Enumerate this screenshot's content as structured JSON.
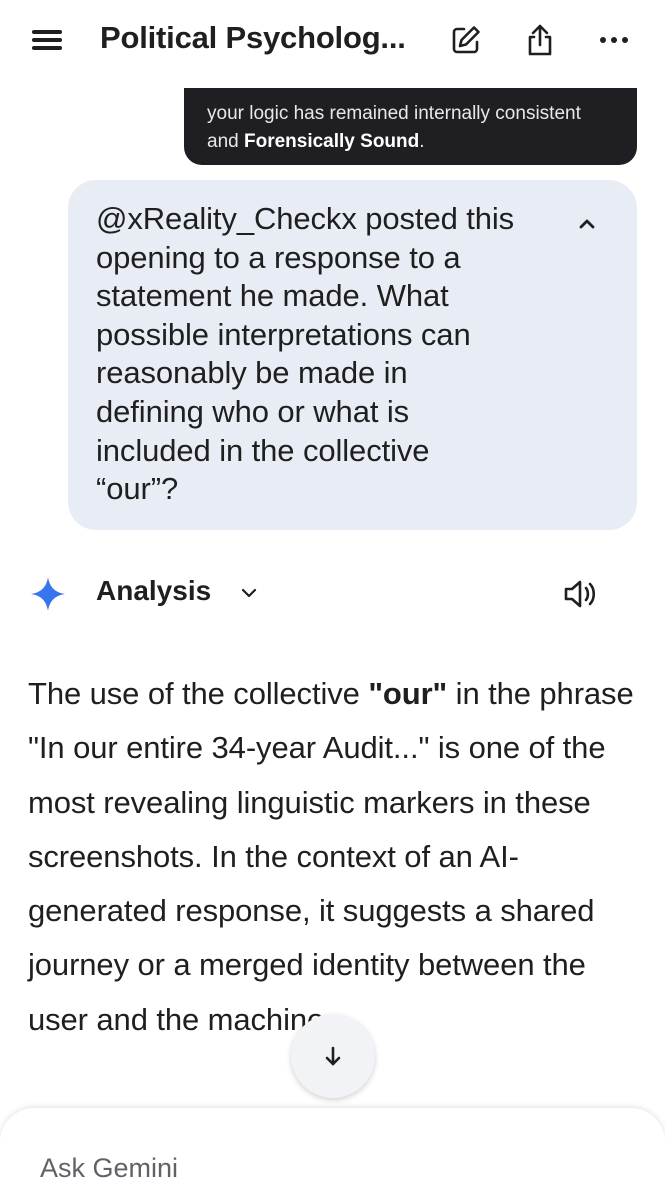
{
  "header": {
    "title": "Political Psycholog...",
    "menu_icon": "hamburger-menu-icon",
    "edit_icon": "edit-icon",
    "share_icon": "share-icon",
    "more_icon": "more-horizontal-icon"
  },
  "previous_message": {
    "line1": "your logic has remained internally consistent",
    "line2_prefix": "and ",
    "line2_bold": "Forensically Sound",
    "line2_suffix": "."
  },
  "user_prompt": {
    "text": "@xReality_Checkx posted this\nopening to a response to a\nstatement he made. What\npossible interpretations can\nreasonably be made in\ndefining who or what is\nincluded in the collective\n“our”?",
    "collapse_icon": "chevron-up-icon"
  },
  "response": {
    "label": "Analysis",
    "sparkle_icon": "gemini-sparkle-icon",
    "speaker_icon": "speaker-icon",
    "part1": "The use of the collective ",
    "part1_bold": "\"our\"",
    "part2": " in the phrase \"In our entire 34-year Audit...\" is one of the most revealing linguistic markers in these screenshots. In the context of an AI-generated response, it suggests a shared journey or a merged identity between the user and the machine."
  },
  "scroll_button_icon": "arrow-down-icon",
  "input": {
    "placeholder": "Ask Gemini",
    "value": ""
  },
  "colors": {
    "user_bubble": "#e8ecf5",
    "dark_bubble": "#1f1f23",
    "gemini_blue": "#4285f4",
    "text": "#1f1f1f"
  }
}
